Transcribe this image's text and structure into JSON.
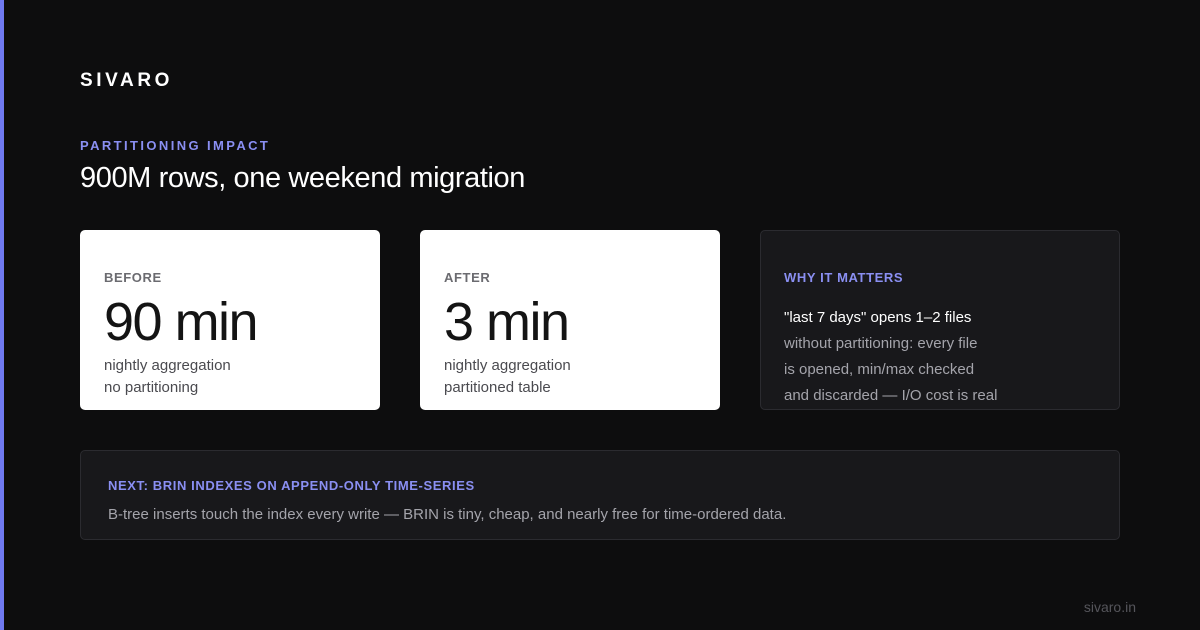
{
  "brand": "SIVARO",
  "eyebrow": "PARTITIONING IMPACT",
  "headline": "900M rows, one weekend migration",
  "before_card": {
    "label": "BEFORE",
    "value": "90 min",
    "line1": "nightly aggregation",
    "line2": "no partitioning"
  },
  "after_card": {
    "label": "AFTER",
    "value": "3 min",
    "line1": "nightly aggregation",
    "line2": "partitioned table"
  },
  "why_card": {
    "title": "WHY IT MATTERS",
    "lead": "\"last 7 days\" opens 1–2 files",
    "lines": [
      "without partitioning: every file",
      "is opened, min/max checked",
      "and discarded — I/O cost is real"
    ]
  },
  "next_card": {
    "title": "NEXT: BRIN INDEXES ON APPEND-ONLY TIME-SERIES",
    "body": "B-tree inserts touch the index every write — BRIN is tiny, cheap, and nearly free for time-ordered data."
  },
  "footer": "sivaro.in",
  "colors": {
    "background": "#0d0d0e",
    "accent": "#6f79f0",
    "accent_text": "#8a8ff2",
    "card_light": "#ffffff",
    "card_dark": "#18181b"
  }
}
